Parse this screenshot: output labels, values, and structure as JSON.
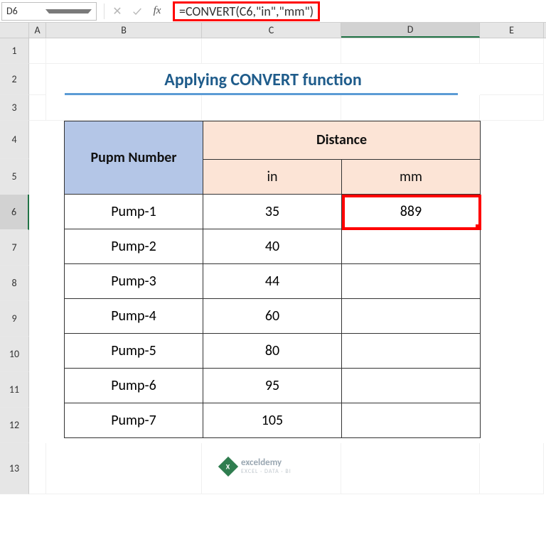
{
  "formula_bar": {
    "name_box_value": "D6",
    "fx_label": "fx",
    "formula_display": "=CONVERT(C6,\"in\",\"mm\")"
  },
  "columns": {
    "A": "A",
    "B": "B",
    "C": "C",
    "D": "D",
    "E": "E"
  },
  "row_numbers": [
    "1",
    "2",
    "3",
    "4",
    "5",
    "6",
    "7",
    "8",
    "9",
    "10",
    "11",
    "12",
    "13"
  ],
  "title": "Applying CONVERT function",
  "table": {
    "header_pump": "Pupm Number",
    "header_distance": "Distance",
    "sub_in": "in",
    "sub_mm": "mm",
    "rows": [
      {
        "pump": "Pump-1",
        "in": "35",
        "mm": "889"
      },
      {
        "pump": "Pump-2",
        "in": "40",
        "mm": ""
      },
      {
        "pump": "Pump-3",
        "in": "44",
        "mm": ""
      },
      {
        "pump": "Pump-4",
        "in": "60",
        "mm": ""
      },
      {
        "pump": "Pump-5",
        "in": "80",
        "mm": ""
      },
      {
        "pump": "Pump-6",
        "in": "95",
        "mm": ""
      },
      {
        "pump": "Pump-7",
        "in": "105",
        "mm": ""
      }
    ]
  },
  "watermark": {
    "name": "exceldemy",
    "tag": "EXCEL · DATA · BI"
  },
  "active_cell": "D6",
  "chart_data": {
    "type": "table",
    "title": "Applying CONVERT function",
    "columns": [
      "Pupm Number",
      "in",
      "mm"
    ],
    "rows": [
      [
        "Pump-1",
        35,
        889
      ],
      [
        "Pump-2",
        40,
        null
      ],
      [
        "Pump-3",
        44,
        null
      ],
      [
        "Pump-4",
        60,
        null
      ],
      [
        "Pump-5",
        80,
        null
      ],
      [
        "Pump-6",
        95,
        null
      ],
      [
        "Pump-7",
        105,
        null
      ]
    ]
  }
}
